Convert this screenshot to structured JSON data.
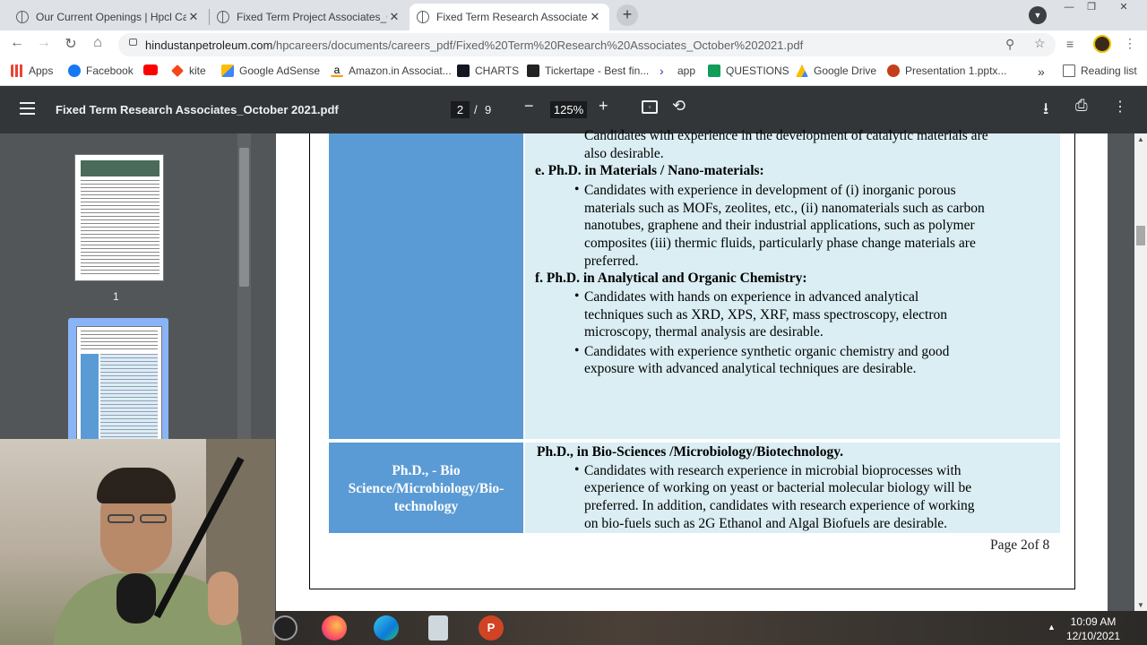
{
  "browser": {
    "tabs": [
      {
        "title": "Our Current Openings | Hpcl Car",
        "active": false
      },
      {
        "title": "Fixed Term Project Associates_Oc",
        "active": false
      },
      {
        "title": "Fixed Term Research Associates_(",
        "active": true
      }
    ],
    "new_tab": "+",
    "url_host": "hindustanpetroleum.com",
    "url_path": "/hpcareers/documents/careers_pdf/Fixed%20Term%20Research%20Associates_October%202021.pdf",
    "bookmarks": [
      {
        "label": "Apps",
        "color": "#ea4335"
      },
      {
        "label": "Facebook",
        "color": "#1877f2"
      },
      {
        "label": "",
        "color": "#ff0000"
      },
      {
        "label": "kite",
        "color": "#f6461a"
      },
      {
        "label": "Google AdSense",
        "color": "#fbbc04"
      },
      {
        "label": "Amazon.in Associat...",
        "color": "#232f3e"
      },
      {
        "label": "CHARTS",
        "color": "#131722"
      },
      {
        "label": "Tickertape - Best fin...",
        "color": "#222"
      },
      {
        "label": "app",
        "color": "#4b2aa8"
      },
      {
        "label": "QUESTIONS",
        "color": "#0f9d58"
      },
      {
        "label": "Google Drive",
        "color": "#fbbc04"
      },
      {
        "label": "Presentation 1.pptx...",
        "color": "#c43e1c"
      }
    ],
    "more_bookmarks": "»",
    "reading_list": "Reading list"
  },
  "viewer": {
    "title": "Fixed Term Research Associates_October 2021.pdf",
    "page_current": "2",
    "page_sep": "/",
    "page_total": "9",
    "zoom": "125%",
    "thumb1_label": "1"
  },
  "pdf": {
    "upper_lines": [
      "Candidates with experience in the development of catalytic materials are",
      "also desirable."
    ],
    "section_e": "e.   Ph.D. in Materials / Nano-materials:",
    "e_lines": [
      "Candidates with experience in development of (i) inorganic porous",
      "materials such as MOFs, zeolites, etc., (ii) nanomaterials such as carbon",
      "nanotubes, graphene and their industrial applications, such as polymer",
      "composites (iii) thermic fluids, particularly phase change materials are",
      "preferred."
    ],
    "section_f": "f.   Ph.D. in Analytical and Organic Chemistry:",
    "f1_lines": [
      "Candidates with hands on experience in advanced analytical",
      "techniques such as XRD, XPS, XRF, mass spectroscopy, electron",
      "microscopy, thermal analysis are desirable."
    ],
    "f2_lines": [
      "Candidates with experience synthetic organic chemistry and good",
      "exposure with advanced analytical techniques are desirable."
    ],
    "bio_left": [
      "Ph.D., - Bio",
      "Science/Microbiology/Bio-",
      "technology"
    ],
    "bio_heading": "Ph.D., in Bio-Sciences /Microbiology/Biotechnology.",
    "bio_lines": [
      "Candidates with research experience in microbial bioprocesses with",
      "experience of working on yeast or bacterial molecular biology will be",
      "preferred. In addition, candidates with research experience of working",
      "on bio-fuels such as 2G Ethanol and Algal Biofuels are desirable."
    ],
    "footer": "Page 2of 8"
  },
  "taskbar": {
    "time": "10:09 AM",
    "date": "12/10/2021"
  }
}
